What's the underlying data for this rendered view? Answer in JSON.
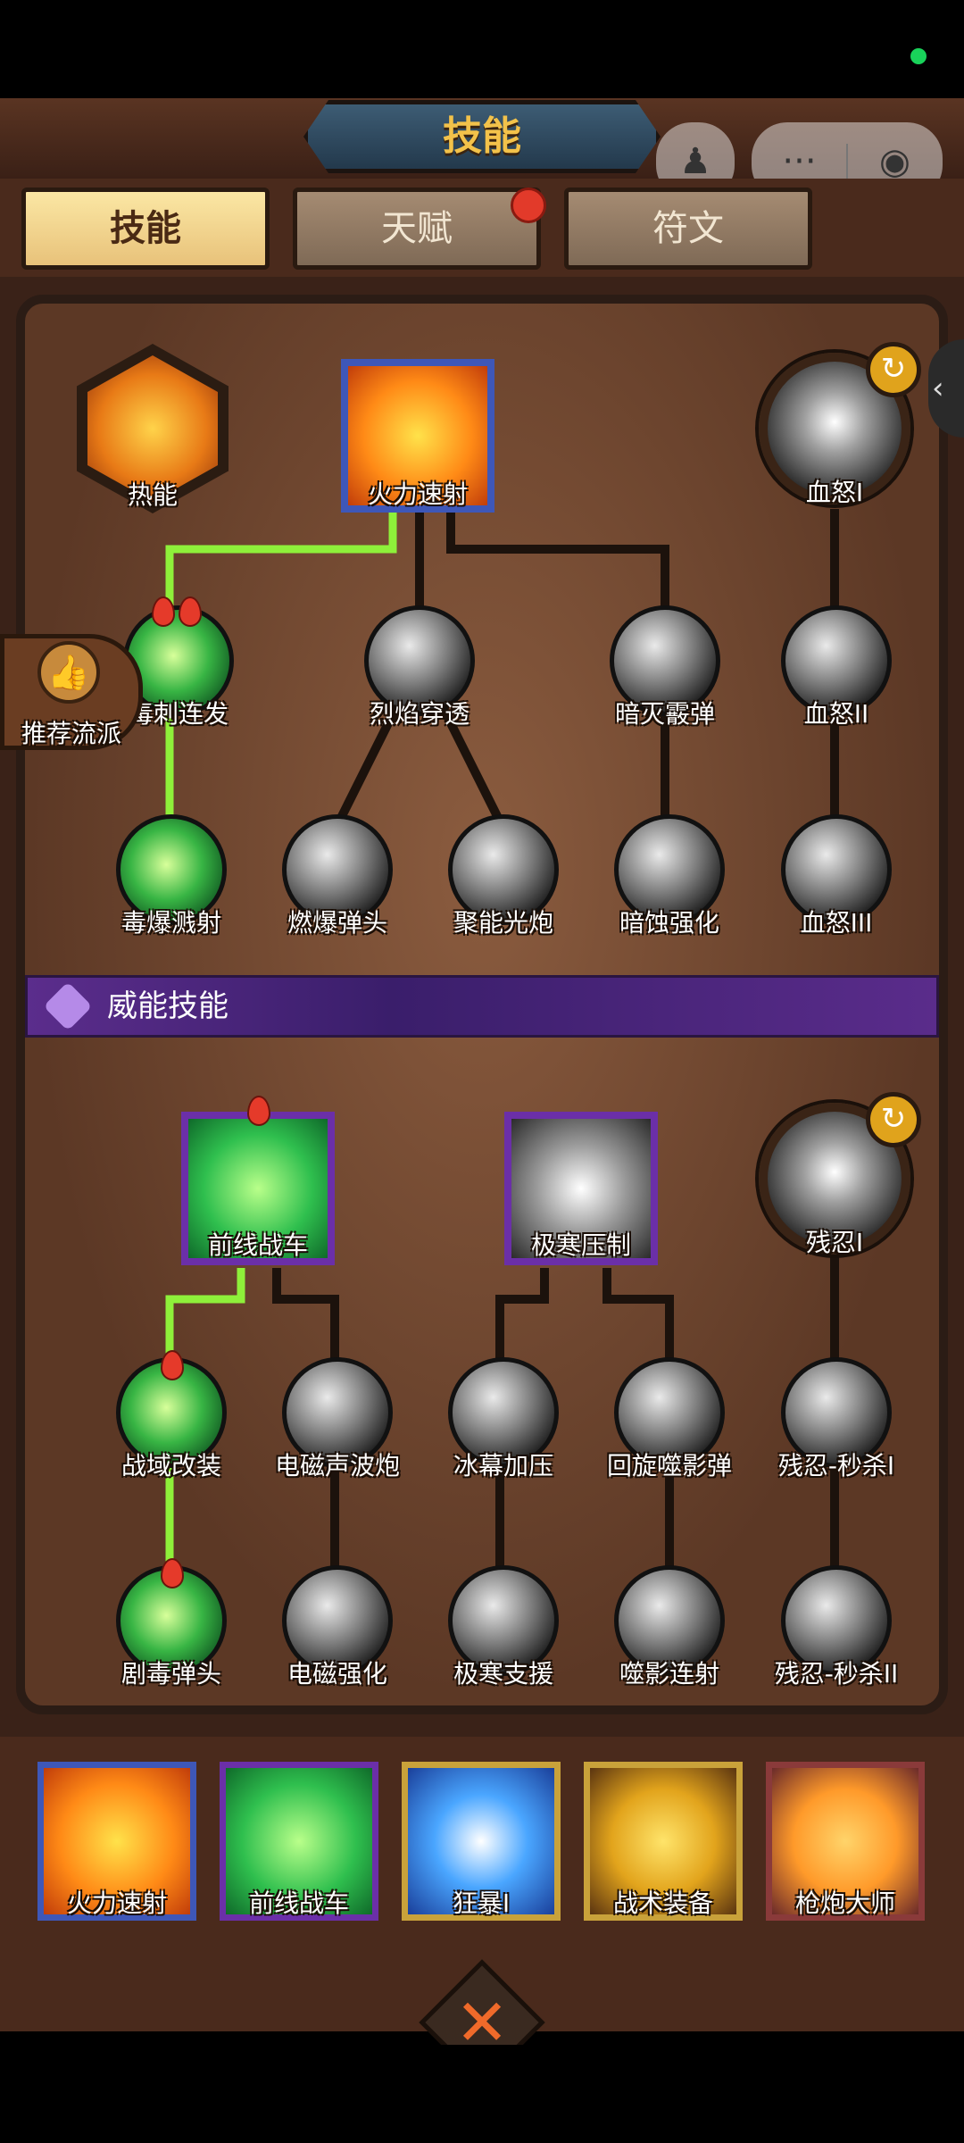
{
  "header": {
    "title": "技能"
  },
  "tabs": [
    {
      "label": "技能",
      "active": true
    },
    {
      "label": "天赋",
      "active": false,
      "badge": true
    },
    {
      "label": "符文",
      "active": false
    }
  ],
  "recommend": {
    "label": "推荐流派",
    "icon": "thumbs-up-icon"
  },
  "skill_tree": {
    "top_row": [
      {
        "name": "热能",
        "shape": "hexagon"
      },
      {
        "name": "火力速射",
        "shape": "square"
      },
      {
        "name": "血怒I",
        "shape": "big-circle",
        "refreshable": true
      }
    ],
    "mid_row": [
      "毒刺连发",
      "烈焰穿透",
      "暗灭霰弹",
      "血怒II"
    ],
    "bottom_row": [
      "毒爆溅射",
      "燃爆弹头",
      "聚能光炮",
      "暗蚀强化",
      "血怒III"
    ]
  },
  "section": {
    "label": "威能技能"
  },
  "power_tree": {
    "top_row": [
      {
        "name": "前线战车",
        "shape": "square"
      },
      {
        "name": "极寒压制",
        "shape": "square"
      },
      {
        "name": "残忍I",
        "shape": "big-circle",
        "refreshable": true
      }
    ],
    "mid_row": [
      "战域改装",
      "电磁声波炮",
      "冰幕加压",
      "回旋噬影弹",
      "残忍-秒杀I"
    ],
    "bottom_row": [
      "剧毒弹头",
      "电磁强化",
      "极寒支援",
      "噬影连射",
      "残忍-秒杀II"
    ]
  },
  "equipped": [
    "火力速射",
    "前线战车",
    "狂暴I",
    "战术装备",
    "枪炮大师"
  ],
  "icons": {
    "refresh": "↻",
    "close": "✕",
    "chevron": "‹",
    "wx_avatar": "♟",
    "wx_more": "···",
    "wx_target": "◉"
  },
  "colors": {
    "path_green": "#8ef03a",
    "connector": "#1c120c",
    "accent_gold": "#f3c24a",
    "purple": "#5b2d8c"
  }
}
